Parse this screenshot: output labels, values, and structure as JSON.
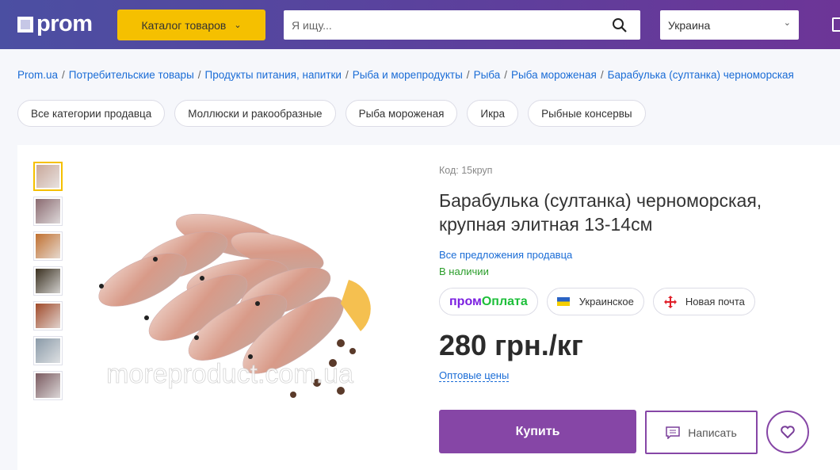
{
  "header": {
    "logo": "prom",
    "catalog_label": "Каталог товаров",
    "search_placeholder": "Я ищу...",
    "region": "Украина"
  },
  "breadcrumbs": [
    "Prom.ua",
    "Потребительские товары",
    "Продукты питания, напитки",
    "Рыба и морепродукты",
    "Рыба",
    "Рыба мороженая",
    "Барабулька (султанка) черноморская"
  ],
  "chips": [
    "Все категории продавца",
    "Моллюски и ракообразные",
    "Рыба мороженая",
    "Икра",
    "Рыбные консервы"
  ],
  "gallery": {
    "thumb_colors": [
      "#c9a89a",
      "#8a6a70",
      "#c07030",
      "#3a3020",
      "#a04a2a",
      "#8a9aa8",
      "#7a5a60"
    ],
    "watermark": "moreproduct.com.ua"
  },
  "product": {
    "code": "Код: 15круп",
    "title": "Барабулька (султанка) черноморская, крупная элитная 13-14см",
    "seller_link": "Все предложения продавца",
    "stock": "В наличии",
    "badges": {
      "pay_part1": "пром",
      "pay_part2": "Оплата",
      "origin": "Украинское",
      "delivery": "Новая почта"
    },
    "price": "280 грн./кг",
    "wholesale": "Оптовые цены",
    "buy_label": "Купить",
    "write_label": "Написать"
  },
  "colors": {
    "accent": "#8646a6",
    "catalog": "#f5c000",
    "link": "#1a6cd6",
    "stock": "#2a9d2a"
  }
}
